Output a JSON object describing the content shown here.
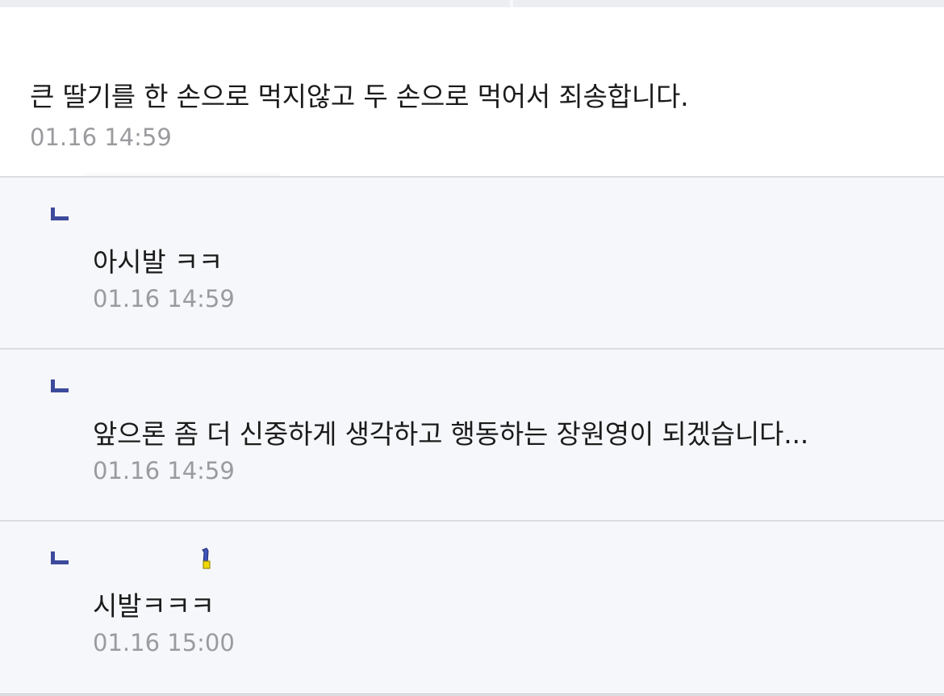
{
  "comments": [
    {
      "text": "큰 딸기를 한 손으로 먹지않고 두 손으로 먹어서 죄송합니다.",
      "time": "01.16 14:59"
    }
  ],
  "replies": [
    {
      "text": "아시발 ㅋㅋ",
      "time": "01.16 14:59"
    },
    {
      "text": "앞으론 좀 더 신중하게 생각하고 행동하는 장원영이 되겠습니다...",
      "time": "01.16 14:59"
    },
    {
      "text": "시발ㅋㅋㅋ",
      "time": "01.16 15:00",
      "author_badge_icon": "emblem-icon"
    }
  ],
  "colors": {
    "reply_marker": "#3d4a9c",
    "reply_background": "#f6f7fa",
    "timestamp": "#9b9b9f",
    "divider": "#dcdde2"
  }
}
